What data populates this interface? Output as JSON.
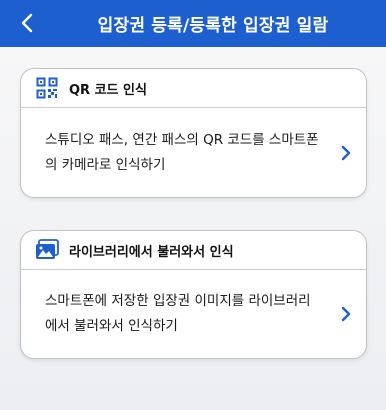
{
  "header": {
    "title": "입장권 등록/등록한 입장권 일람",
    "bg_color": "#1e5fd0",
    "back_icon": "chevron-left-icon"
  },
  "cards": [
    {
      "title": "QR 코드 인식",
      "description": "스튜디오 패스, 연간 패스의 QR 코드를 스마트폰의 카메라로 인식하기",
      "icon": "qr-code-icon",
      "arrow_icon": "chevron-right-icon"
    },
    {
      "title": "라이브러리에서 불러와서 인식",
      "description": "스마트폰에 저장한 입장권 이미지를 라이브러리에서 불러와서 인식하기",
      "icon": "photo-library-icon",
      "arrow_icon": "chevron-right-icon"
    }
  ],
  "accent_color": "#1e5fd0"
}
